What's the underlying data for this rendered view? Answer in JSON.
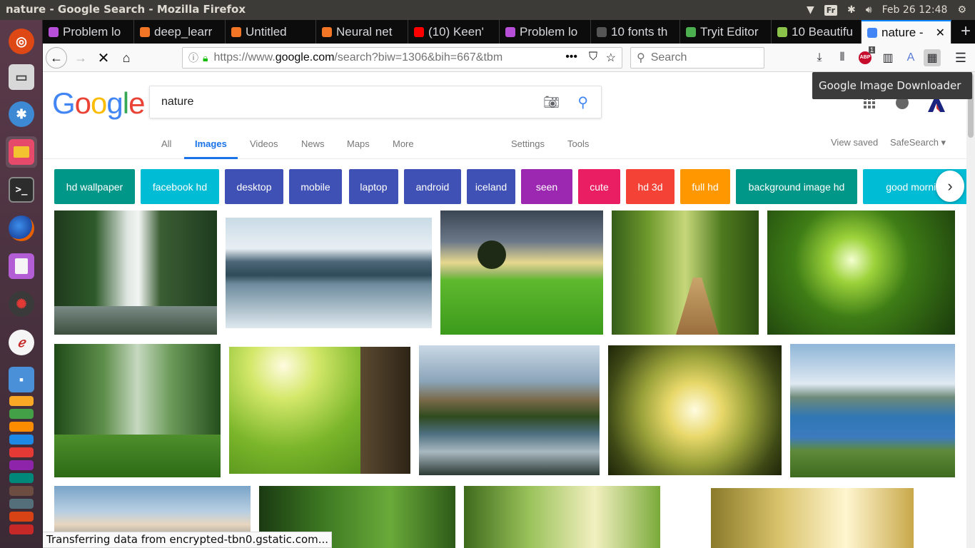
{
  "system": {
    "window_title": "nature - Google Search - Mozilla Firefox",
    "keyboard": "Fr",
    "datetime": "Feb 26 12:48"
  },
  "tabs": [
    {
      "label": "Problem lo",
      "color": "#b84fd8"
    },
    {
      "label": "deep_learr",
      "color": "#f37626"
    },
    {
      "label": "Untitled",
      "color": "#f37626"
    },
    {
      "label": "Neural net",
      "color": "#f37626"
    },
    {
      "label": "(10) Keen'",
      "color": "#ff0000"
    },
    {
      "label": "Problem lo",
      "color": "#b84fd8"
    },
    {
      "label": "10 fonts th",
      "color": "#555555"
    },
    {
      "label": "Tryit Editor",
      "color": "#4caf50"
    },
    {
      "label": "10 Beautifu",
      "color": "#8bc34a"
    },
    {
      "label": "nature -",
      "color": "#4285f4"
    }
  ],
  "nav": {
    "url_prefix": "https://www.",
    "url_domain": "google.com",
    "url_path": "/search?biw=1306&bih=667&tbm",
    "search_placeholder": "Search",
    "adblock_count": "1"
  },
  "tooltip": "Google Image Downloader",
  "google": {
    "query": "nature",
    "tabs": [
      "All",
      "Images",
      "Videos",
      "News",
      "Maps",
      "More"
    ],
    "tools": [
      "Settings",
      "Tools"
    ],
    "view_saved": "View saved",
    "safesearch": "SafeSearch ▾",
    "chips": [
      {
        "label": "hd wallpaper",
        "color": "#009688"
      },
      {
        "label": "facebook hd",
        "color": "#00bcd4"
      },
      {
        "label": "desktop",
        "color": "#3f51b5"
      },
      {
        "label": "mobile",
        "color": "#3f51b5"
      },
      {
        "label": "laptop",
        "color": "#3f51b5"
      },
      {
        "label": "android",
        "color": "#3f51b5"
      },
      {
        "label": "iceland",
        "color": "#3f51b5"
      },
      {
        "label": "seen",
        "color": "#9c27b0"
      },
      {
        "label": "cute",
        "color": "#e91e63"
      },
      {
        "label": "hd 3d",
        "color": "#f44336"
      },
      {
        "label": "full hd",
        "color": "#ff9800"
      },
      {
        "label": "background image hd",
        "color": "#009688"
      },
      {
        "label": "good morning",
        "color": "#00bcd4"
      }
    ],
    "images": [
      "waterfall in forest",
      "mountain lake reflection",
      "tree in green field",
      "park path with bench",
      "large tree with person",
      "misty forest path",
      "sunlit meadow with flowers",
      "valley river reflection",
      "looking up at tree canopy",
      "alpine lake",
      "snowy mountain peaks",
      "green forest trail",
      "sunlit forest",
      "golden forest light"
    ]
  },
  "status": "Transferring data from encrypted-tbn0.gstatic.com..."
}
